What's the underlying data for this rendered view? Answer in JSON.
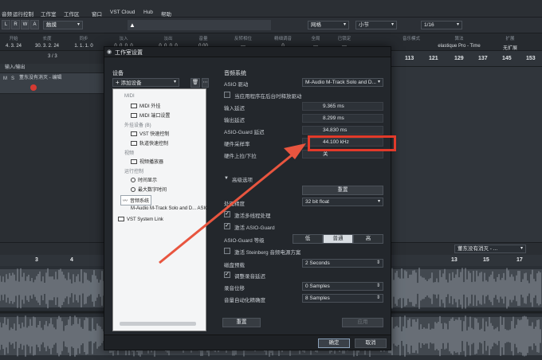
{
  "menubar": {
    "items": [
      "音频",
      "运行控制",
      "工作室",
      "工作区",
      "窗口",
      "VST Cloud",
      "Hub",
      "帮助"
    ]
  },
  "toolbar": {
    "buttons": [
      "L",
      "R",
      "W",
      "A"
    ],
    "track_dropdown": "触摸",
    "grid_label": "网格",
    "bar_label": "小节",
    "quantize": "1/16"
  },
  "infobar": {
    "cols": [
      {
        "h": "开始",
        "v": "4. 3. 24"
      },
      {
        "h": "长度",
        "v": "30. 3. 2. 24"
      },
      {
        "h": "同步",
        "v": "1. 1. 1. 0"
      },
      {
        "h": "淡入",
        "v": "0. 0. 0. 0"
      },
      {
        "h": "淡出",
        "v": "0. 0. 0. 0"
      },
      {
        "h": "音量",
        "v": "0.00"
      },
      {
        "h": "反转相位",
        "v": "—"
      },
      {
        "h": "精细调音",
        "v": "0"
      },
      {
        "h": "全局",
        "v": "—"
      },
      {
        "h": "已锁定",
        "v": "—"
      }
    ],
    "mode_label": "音乐模式",
    "algorithm_label": "算法",
    "algorithm_value": "elastique Pro - Time",
    "extension_label": "扩展",
    "extension_value": "无扩展"
  },
  "left": {
    "counter": "3 / 3",
    "io_label": "输入/输出",
    "track_name": "董东没有消灭 - 编辑"
  },
  "ruler": {
    "marks": [
      "113",
      "121",
      "129",
      "137",
      "145",
      "153"
    ]
  },
  "lower_ruler": {
    "marks": [
      "3",
      "4",
      "13",
      "15",
      "17"
    ],
    "track_label": "董东没有消灭 - ..."
  },
  "dialog": {
    "title": "工作室设置",
    "devices_label": "设备",
    "add_device": "添加设备",
    "list": [
      {
        "type": "group",
        "label": "MIDI"
      },
      {
        "type": "item",
        "label": "MIDI 外挂"
      },
      {
        "type": "item",
        "label": "MIDI 端口设置"
      },
      {
        "type": "group",
        "label": "外挂设备 (B)"
      },
      {
        "type": "item",
        "label": "VST 快速控制"
      },
      {
        "type": "item",
        "label": "轨道快速控制"
      },
      {
        "type": "group",
        "label": "视频"
      },
      {
        "type": "item",
        "label": "视频播放器"
      },
      {
        "type": "group",
        "label": "运行控制"
      },
      {
        "type": "item",
        "label": "时间显示"
      },
      {
        "type": "item",
        "label": "最大数字时间"
      },
      {
        "type": "selected",
        "label": "音频系统"
      },
      {
        "type": "item",
        "label": "M-Audio M-Track Solo and D... ASIO"
      },
      {
        "type": "item",
        "label": "VST System Link"
      }
    ],
    "audio_system_label": "音频系统",
    "asio_driver_label": "ASIO 驱动",
    "asio_driver_value": "M-Audio M-Track Solo and D...",
    "release_driver_label": "当应用程序在后台时释放驱动",
    "input_latency_label": "输入延迟",
    "input_latency_value": "9.365 ms",
    "output_latency_label": "输出延迟",
    "output_latency_value": "8.299 ms",
    "asio_guard_latency_label": "ASIO-Guard 延迟",
    "asio_guard_latency_value": "34.830 ms",
    "sample_rate_label": "硬件采样率",
    "sample_rate_value": "44.100 kHz",
    "pull_label": "硬件上拉/下拉",
    "pull_value": "关",
    "advanced_label": "高级选项",
    "reset_label": "重置",
    "precision_label": "处理精度",
    "precision_value": "32 bit float",
    "multiprocessing_label": "激活多线程处理",
    "asio_guard_enable_label": "激活 ASIO-Guard",
    "asio_guard_level_label": "ASIO-Guard 等级",
    "levels": [
      "低",
      "普通",
      "高"
    ],
    "level_selected": "普通",
    "steinberg_power_label": "激活 Steinberg 音频电源方案",
    "disk_preload_label": "磁盘预载",
    "disk_preload_value": "2 Seconds",
    "adjust_latency_label": "调整录音延迟",
    "record_shift_label": "录音位移",
    "record_shift_value": "0 Samples",
    "volume_auto_label": "音量自动化精确度",
    "volume_auto_value": "8 Samples",
    "reset_bottom_label": "重置",
    "apply_label": "应用",
    "ok_label": "确定",
    "cancel_label": "取消"
  },
  "colors": {
    "highlight": "#e23a2a",
    "arrow": "#e8553f",
    "record": "#d63a32"
  }
}
